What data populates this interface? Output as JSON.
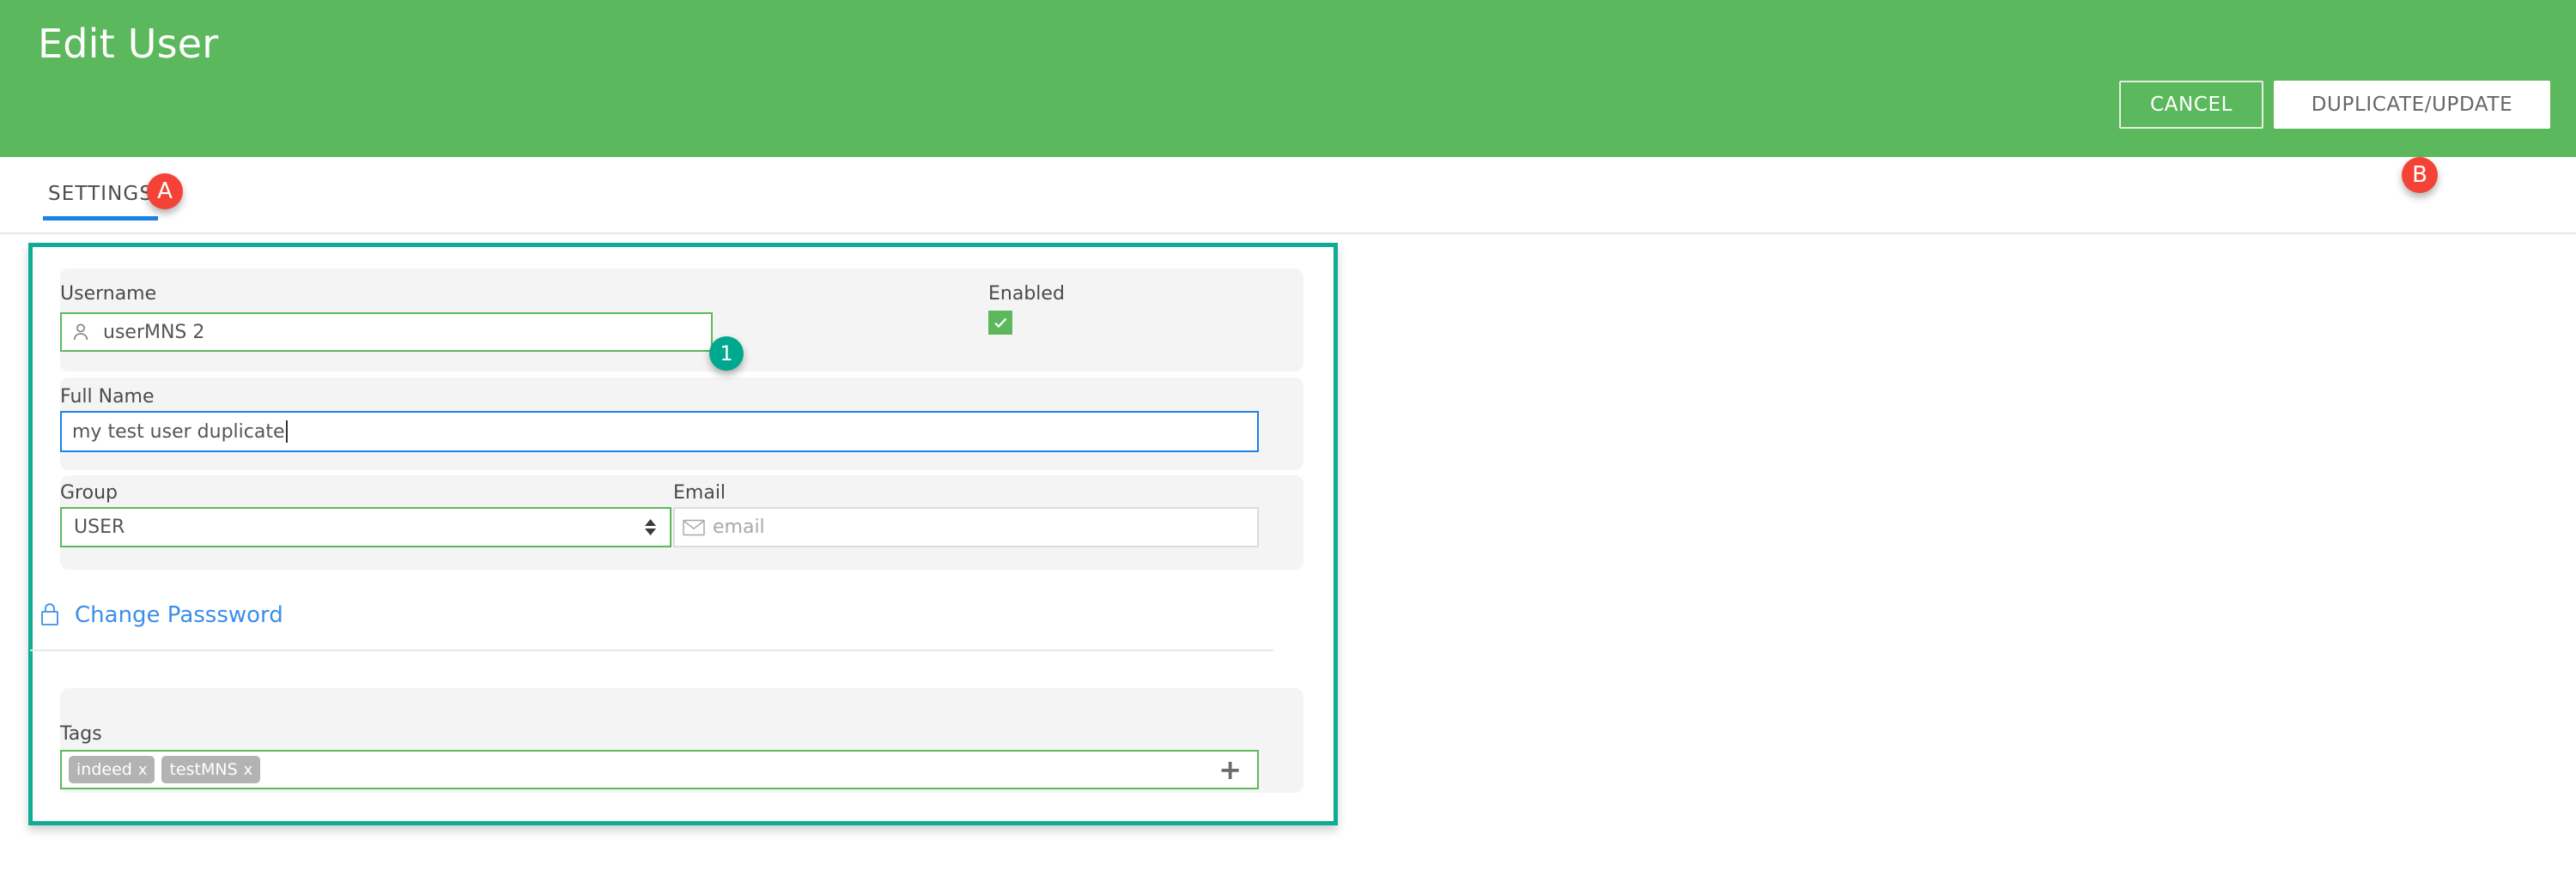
{
  "header": {
    "title": "Edit User",
    "cancel_label": "CANCEL",
    "submit_label": "DUPLICATE/UPDATE",
    "background_color": "#5cb85c"
  },
  "tabs": [
    {
      "label": "SETTINGS",
      "active": true
    }
  ],
  "markers": [
    {
      "id": "A",
      "label": "A",
      "color": "#f44336"
    },
    {
      "id": "B",
      "label": "B",
      "color": "#f44336"
    },
    {
      "id": "1",
      "label": "1",
      "color": "#00a88f"
    }
  ],
  "form": {
    "username": {
      "label": "Username",
      "value": "userMNS 2",
      "icon": "user-icon",
      "border_color": "#5cb85c"
    },
    "enabled": {
      "label": "Enabled",
      "checked": true,
      "check_glyph": "✓",
      "color": "#5cb85c"
    },
    "full_name": {
      "label": "Full Name",
      "value": "my test user duplicate",
      "focused": true,
      "border_color": "#1b81e5"
    },
    "group": {
      "label": "Group",
      "value": "USER",
      "options": [
        "USER"
      ],
      "border_color": "#5cb85c"
    },
    "email": {
      "label": "Email",
      "value": "",
      "placeholder": "email",
      "icon": "envelope-icon",
      "border_color": "#dcdcdc"
    },
    "change_password": {
      "label": "Change Passsword",
      "icon": "lock-icon",
      "color": "#3b8ee8"
    },
    "tags": {
      "label": "Tags",
      "chips": [
        {
          "text": "indeed",
          "remove": "x"
        },
        {
          "text": "testMNS",
          "remove": "x"
        }
      ],
      "add_glyph": "+",
      "border_color": "#5cb85c"
    }
  },
  "card": {
    "highlight_color": "#0fab94"
  }
}
